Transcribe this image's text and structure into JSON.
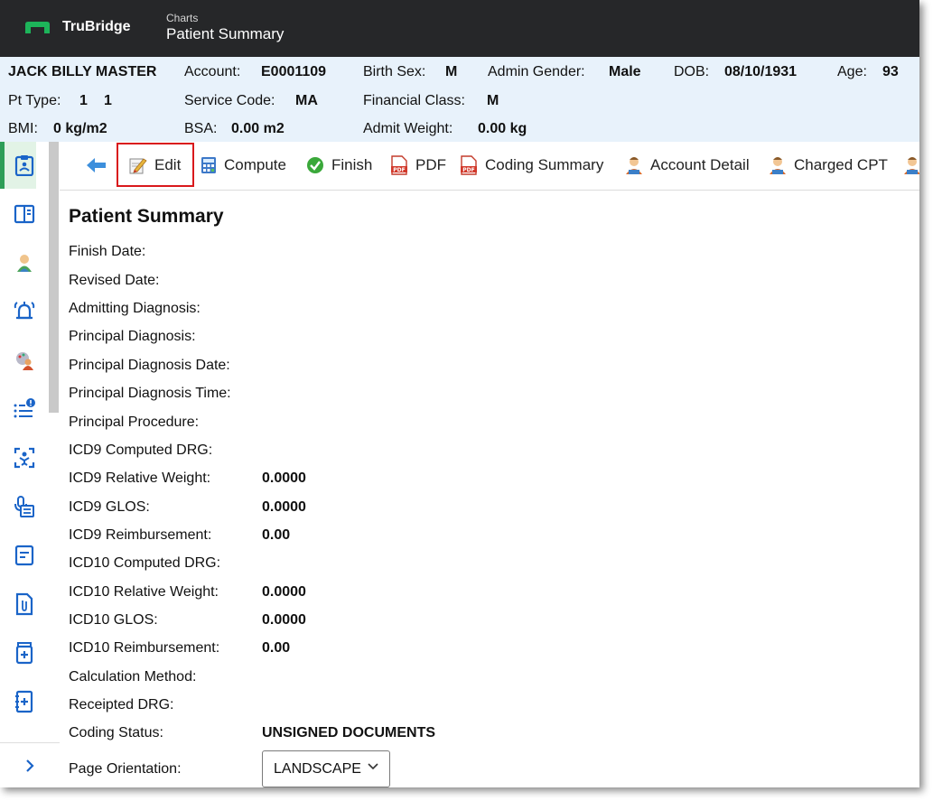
{
  "app": {
    "brand": "TruBridge",
    "breadcrumb": "Charts",
    "page": "Patient Summary"
  },
  "patient": {
    "name": "JACK BILLY MASTER",
    "account_label": "Account:",
    "account": "E0001109",
    "birth_sex_label": "Birth Sex:",
    "birth_sex": "M",
    "admin_gender_label": "Admin Gender:",
    "admin_gender": "Male",
    "dob_label": "DOB:",
    "dob": "08/10/1931",
    "age_label": "Age:",
    "age": "93",
    "pt_type_label": "Pt Type:",
    "pt_type_a": "1",
    "pt_type_b": "1",
    "service_code_label": "Service Code:",
    "service_code": "MA",
    "financial_class_label": "Financial Class:",
    "financial_class": "M",
    "bmi_label": "BMI:",
    "bmi": "0 kg/m2",
    "bsa_label": "BSA:",
    "bsa": "0.00 m2",
    "admit_weight_label": "Admit Weight:",
    "admit_weight": "0.00 kg"
  },
  "toolbar": {
    "edit": "Edit",
    "compute": "Compute",
    "finish": "Finish",
    "pdf": "PDF",
    "coding_summary": "Coding Summary",
    "account_detail": "Account Detail",
    "charged_cpt": "Charged CPT"
  },
  "nav_icons": [
    "clipboard-icon",
    "book-icon",
    "person-icon",
    "alarm-icon",
    "palette-person-icon",
    "list-alert-icon",
    "scan-person-icon",
    "microphone-doc-icon",
    "note-icon",
    "attachment-icon",
    "medication-icon",
    "notebook-plus-icon"
  ],
  "summary": {
    "title": "Patient Summary",
    "rows": [
      {
        "label": "Finish Date:",
        "value": ""
      },
      {
        "label": "Revised Date:",
        "value": ""
      },
      {
        "label": "Admitting Diagnosis:",
        "value": ""
      },
      {
        "label": "Principal Diagnosis:",
        "value": ""
      },
      {
        "label": "Principal Diagnosis Date:",
        "value": ""
      },
      {
        "label": "Principal Diagnosis Time:",
        "value": ""
      },
      {
        "label": "Principal Procedure:",
        "value": ""
      },
      {
        "label": "ICD9 Computed DRG:",
        "value": ""
      },
      {
        "label": "ICD9 Relative Weight:",
        "value": "0.0000"
      },
      {
        "label": "ICD9 GLOS:",
        "value": "0.0000"
      },
      {
        "label": "ICD9 Reimbursement:",
        "value": "0.00"
      },
      {
        "label": "ICD10 Computed DRG:",
        "value": ""
      },
      {
        "label": "ICD10 Relative Weight:",
        "value": "0.0000"
      },
      {
        "label": "ICD10 GLOS:",
        "value": "0.0000"
      },
      {
        "label": "ICD10 Reimbursement:",
        "value": "0.00"
      },
      {
        "label": "Calculation Method:",
        "value": ""
      },
      {
        "label": "Receipted DRG:",
        "value": ""
      },
      {
        "label": "Coding Status:",
        "value": "UNSIGNED DOCUMENTS"
      }
    ],
    "orientation_label": "Page Orientation:",
    "orientation_value": "LANDSCAPE"
  },
  "colors": {
    "topbar": "#262729",
    "header_bg": "#e8f2fb",
    "accent_green": "#2e9e57",
    "nav_blue": "#1a64c8",
    "highlight_red": "#d9191c"
  }
}
